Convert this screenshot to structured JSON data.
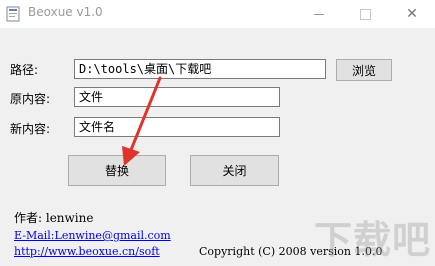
{
  "window": {
    "title": "Beoxue v1.0",
    "controls": {
      "minimize": "—",
      "maximize": "☐",
      "close": "✕"
    }
  },
  "form": {
    "path_label": "路径:",
    "path_value": "D:\\tools\\桌面\\下载吧",
    "browse_button": "浏览",
    "original_label": "原内容:",
    "original_value": "文件",
    "new_label": "新内容:",
    "new_value": "文件名",
    "replace_button": "替换",
    "close_button": "关闭"
  },
  "footer": {
    "author_prefix": "作者: lenwine",
    "email_link": "E-Mail:Lenwine@gmail.com",
    "website_link": "http://www.beoxue.cn/soft",
    "copyright": "Copyright (C) 2008 version 1.0.0"
  },
  "watermark": "下载吧",
  "colors": {
    "arrow": "#e0332c",
    "link": "#0000ee",
    "client_bg": "#f0f0f0"
  }
}
